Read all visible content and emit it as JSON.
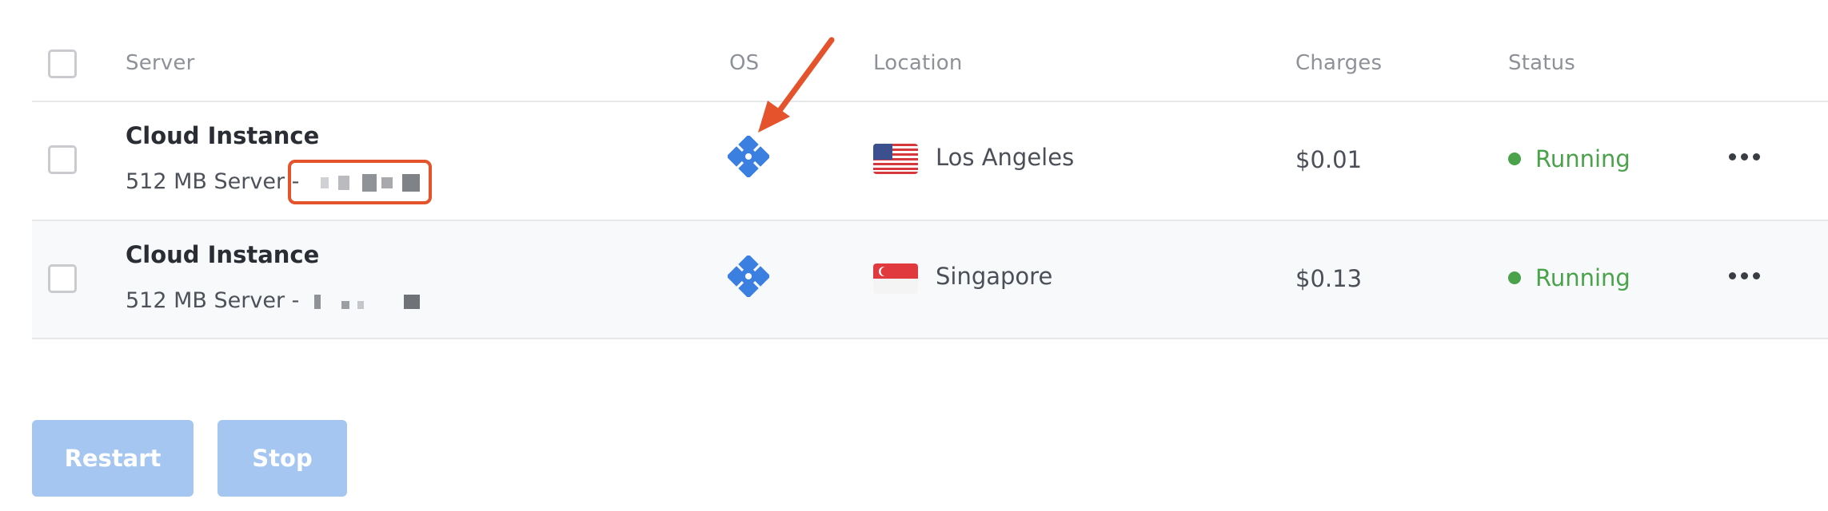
{
  "table": {
    "headers": {
      "server": "Server",
      "os": "OS",
      "location": "Location",
      "charges": "Charges",
      "status": "Status"
    },
    "rows": [
      {
        "title": "Cloud Instance",
        "subtitle": "512 MB Server - ",
        "os_icon": "os-logo-icon",
        "location": "Los Angeles",
        "flag": "us-flag-icon",
        "charges": "$0.01",
        "status": "Running"
      },
      {
        "title": "Cloud Instance",
        "subtitle": "512 MB Server - ",
        "os_icon": "os-logo-icon",
        "location": "Singapore",
        "flag": "sg-flag-icon",
        "charges": "$0.13",
        "status": "Running"
      }
    ]
  },
  "buttons": {
    "restart": "Restart",
    "stop": "Stop"
  },
  "colors": {
    "status_running": "#4aa24a",
    "button_disabled": "#a4c6f0",
    "annotation": "#e4532c",
    "os_icon": "#3b7fe0"
  }
}
